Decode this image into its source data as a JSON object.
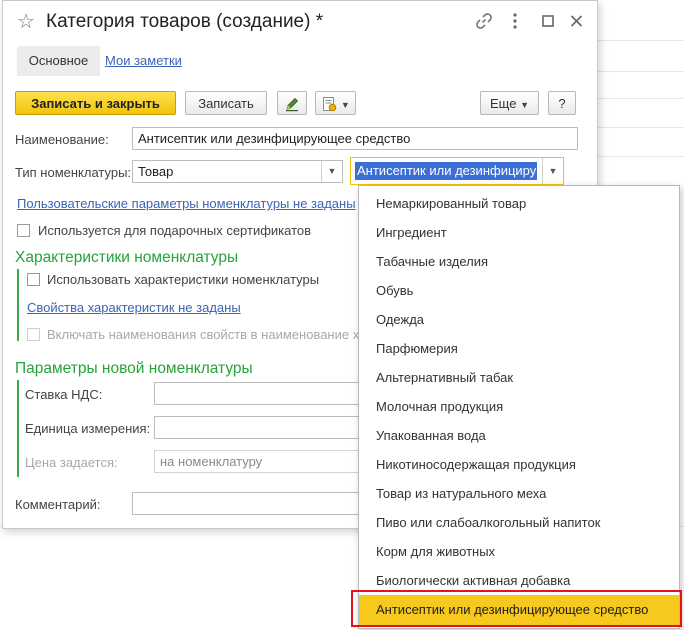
{
  "window": {
    "title": "Категория товаров (создание) *"
  },
  "tabs": {
    "main": "Основное",
    "notes": "Мои заметки"
  },
  "toolbar": {
    "save_close": "Записать и закрыть",
    "save": "Записать",
    "more": "Еще",
    "help": "?"
  },
  "form": {
    "name_label": "Наименование:",
    "name_value": "Антисептик или дезинфицирующее средство",
    "type_label": "Тип номенклатуры:",
    "type_value": "Товар",
    "kind_value": "Антисептик или дезинфицирующее средство",
    "user_params_link": "Пользовательские параметры номенклатуры не заданы",
    "gift_cert_label": "Используется для подарочных сертификатов",
    "char_section": "Характеристики номенклатуры",
    "use_chars_label": "Использовать характеристики номенклатуры",
    "char_props_link": "Свойства характеристик не заданы",
    "include_props_label": "Включать наименования свойств в наименование х",
    "new_params_section": "Параметры новой номенклатуры",
    "vat_label": "Ставка НДС:",
    "unit_label": "Единица измерения:",
    "price_label": "Цена задается:",
    "price_value": "на номенклатуру",
    "comment_label": "Комментарий:"
  },
  "dropdown": {
    "items": [
      "Немаркированный товар",
      "Ингредиент",
      "Табачные изделия",
      "Обувь",
      "Одежда",
      "Парфюмерия",
      "Альтернативный табак",
      "Молочная продукция",
      "Упакованная вода",
      "Никотиносодержащая продукция",
      "Товар из натурального меха",
      "Пиво или слабоалкогольный напиток",
      "Корм для животных",
      "Биологически активная добавка",
      "Антисептик или дезинфицирующее средство"
    ],
    "selected_index": 14
  },
  "colors": {
    "accent_yellow": "#f6c91c",
    "section_green": "#26a33a",
    "link_blue": "#3c64b4",
    "highlight_red": "#e0141b",
    "selection_blue": "#3b6fd6"
  }
}
